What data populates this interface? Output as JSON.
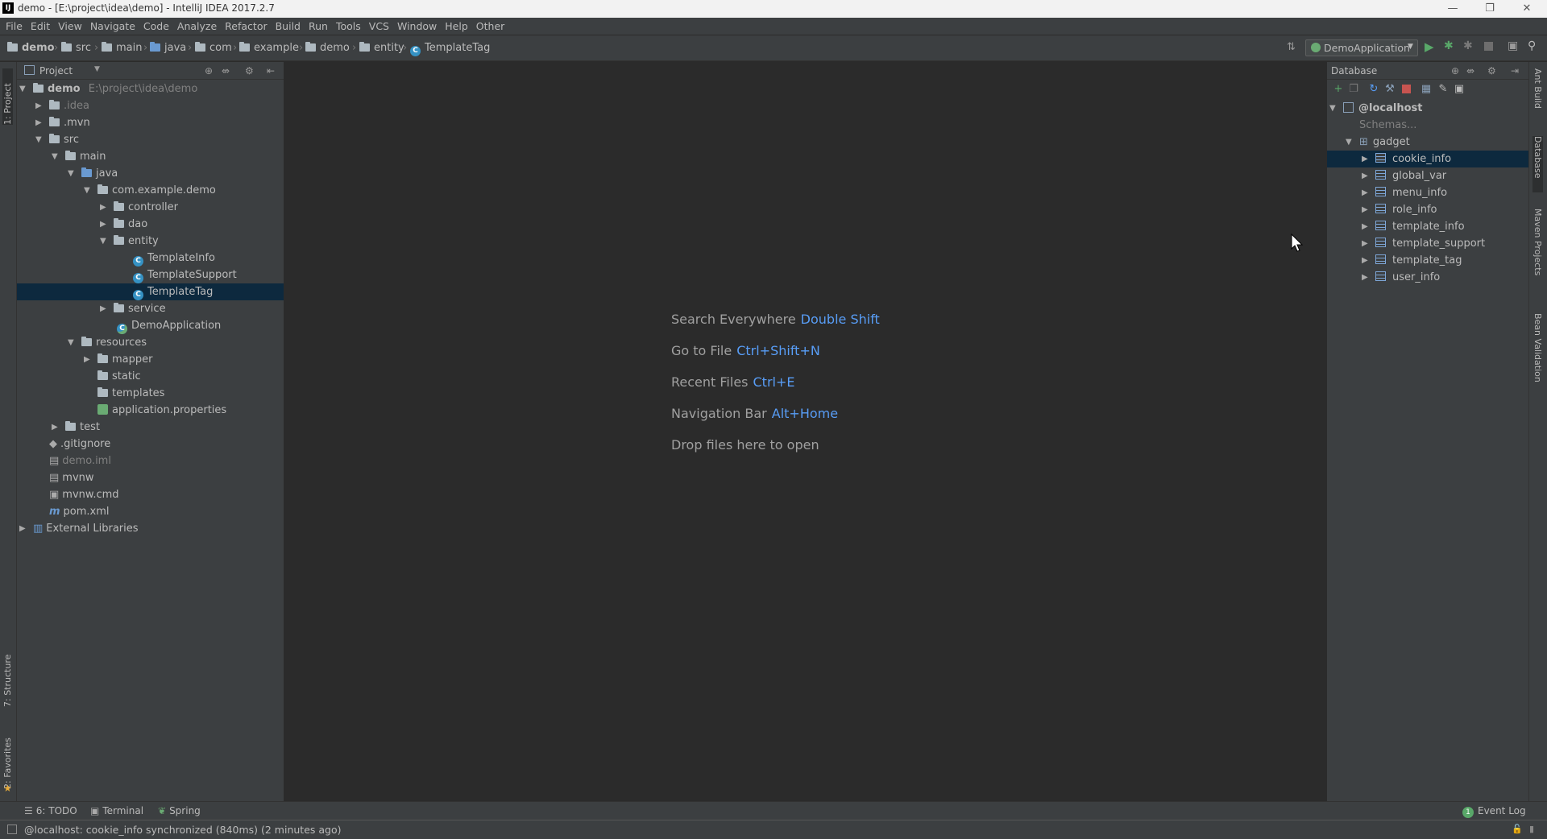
{
  "window": {
    "title": "demo - [E:\\project\\idea\\demo] - IntelliJ IDEA 2017.2.7",
    "app_icon": "IJ",
    "minimize": "—",
    "restore": "❐",
    "close": "✕"
  },
  "menu": [
    "File",
    "Edit",
    "View",
    "Navigate",
    "Code",
    "Analyze",
    "Refactor",
    "Build",
    "Run",
    "Tools",
    "VCS",
    "Window",
    "Help",
    "Other"
  ],
  "breadcrumb": [
    "demo",
    "src",
    "main",
    "java",
    "com",
    "example",
    "demo",
    "entity",
    "TemplateTag"
  ],
  "run_config": "DemoApplication",
  "project_panel": {
    "title": "Project",
    "tree": [
      {
        "label": "demo",
        "extra": "E:\\project\\idea\\demo",
        "icon": "module-folder-icon",
        "arrow": "▼"
      },
      {
        "label": ".idea",
        "icon": "folder-icon",
        "arrow": "▶"
      },
      {
        "label": ".mvn",
        "icon": "folder-icon",
        "arrow": "▶"
      },
      {
        "label": "src",
        "icon": "folder-icon",
        "arrow": "▼"
      },
      {
        "label": "main",
        "icon": "folder-icon",
        "arrow": "▼"
      },
      {
        "label": "java",
        "icon": "source-folder-icon",
        "arrow": "▼"
      },
      {
        "label": "com.example.demo",
        "icon": "package-icon",
        "arrow": "▼"
      },
      {
        "label": "controller",
        "icon": "package-icon",
        "arrow": "▶"
      },
      {
        "label": "dao",
        "icon": "package-icon",
        "arrow": "▶"
      },
      {
        "label": "entity",
        "icon": "package-icon",
        "arrow": "▼"
      },
      {
        "label": "TemplateInfo",
        "icon": "class-icon",
        "arrow": ""
      },
      {
        "label": "TemplateSupport",
        "icon": "class-icon",
        "arrow": ""
      },
      {
        "label": "TemplateTag",
        "icon": "class-icon",
        "arrow": ""
      },
      {
        "label": "service",
        "icon": "package-icon",
        "arrow": "▶"
      },
      {
        "label": "DemoApplication",
        "icon": "spring-class-icon",
        "arrow": ""
      },
      {
        "label": "resources",
        "icon": "resources-folder-icon",
        "arrow": "▼"
      },
      {
        "label": "mapper",
        "icon": "folder-icon",
        "arrow": "▶"
      },
      {
        "label": "static",
        "icon": "folder-icon",
        "arrow": ""
      },
      {
        "label": "templates",
        "icon": "folder-icon",
        "arrow": ""
      },
      {
        "label": "application.properties",
        "icon": "properties-icon",
        "arrow": ""
      },
      {
        "label": "test",
        "icon": "folder-icon",
        "arrow": "▶"
      },
      {
        "label": ".gitignore",
        "icon": "git-icon",
        "arrow": ""
      },
      {
        "label": "demo.iml",
        "icon": "iml-icon",
        "arrow": ""
      },
      {
        "label": "mvnw",
        "icon": "file-icon",
        "arrow": ""
      },
      {
        "label": "mvnw.cmd",
        "icon": "cmd-icon",
        "arrow": ""
      },
      {
        "label": "pom.xml",
        "icon": "maven-icon",
        "arrow": ""
      },
      {
        "label": "External Libraries",
        "icon": "library-icon",
        "arrow": "▶"
      }
    ]
  },
  "editor": {
    "hints": [
      {
        "label": "Search Everywhere",
        "key": "Double Shift"
      },
      {
        "label": "Go to File",
        "key": "Ctrl+Shift+N"
      },
      {
        "label": "Recent Files",
        "key": "Ctrl+E"
      },
      {
        "label": "Navigation Bar",
        "key": "Alt+Home"
      },
      {
        "label": "Drop files here to open",
        "key": ""
      }
    ]
  },
  "database_panel": {
    "title": "Database",
    "host": "@localhost",
    "schemas": "Schemas...",
    "schema": "gadget",
    "tables": [
      "cookie_info",
      "global_var",
      "menu_info",
      "role_info",
      "template_info",
      "template_support",
      "template_tag",
      "user_info"
    ]
  },
  "left_tabs": {
    "project": "1: Project",
    "structure": "7: Structure",
    "favorites": "2: Favorites"
  },
  "right_tabs": {
    "ant": "Ant Build",
    "database": "Database",
    "maven": "Maven Projects",
    "bean": "Bean Validation"
  },
  "bottom_tabs": {
    "todo": "6: TODO",
    "terminal": "Terminal",
    "spring": "Spring",
    "event_log": "Event Log",
    "event_count": "1"
  },
  "status": "@localhost: cookie_info synchronized (840ms) (2 minutes ago)",
  "colors": {
    "accent": "#589df6",
    "selection": "#0d293e",
    "run_green": "#59a869",
    "stop_red": "#c75450"
  }
}
